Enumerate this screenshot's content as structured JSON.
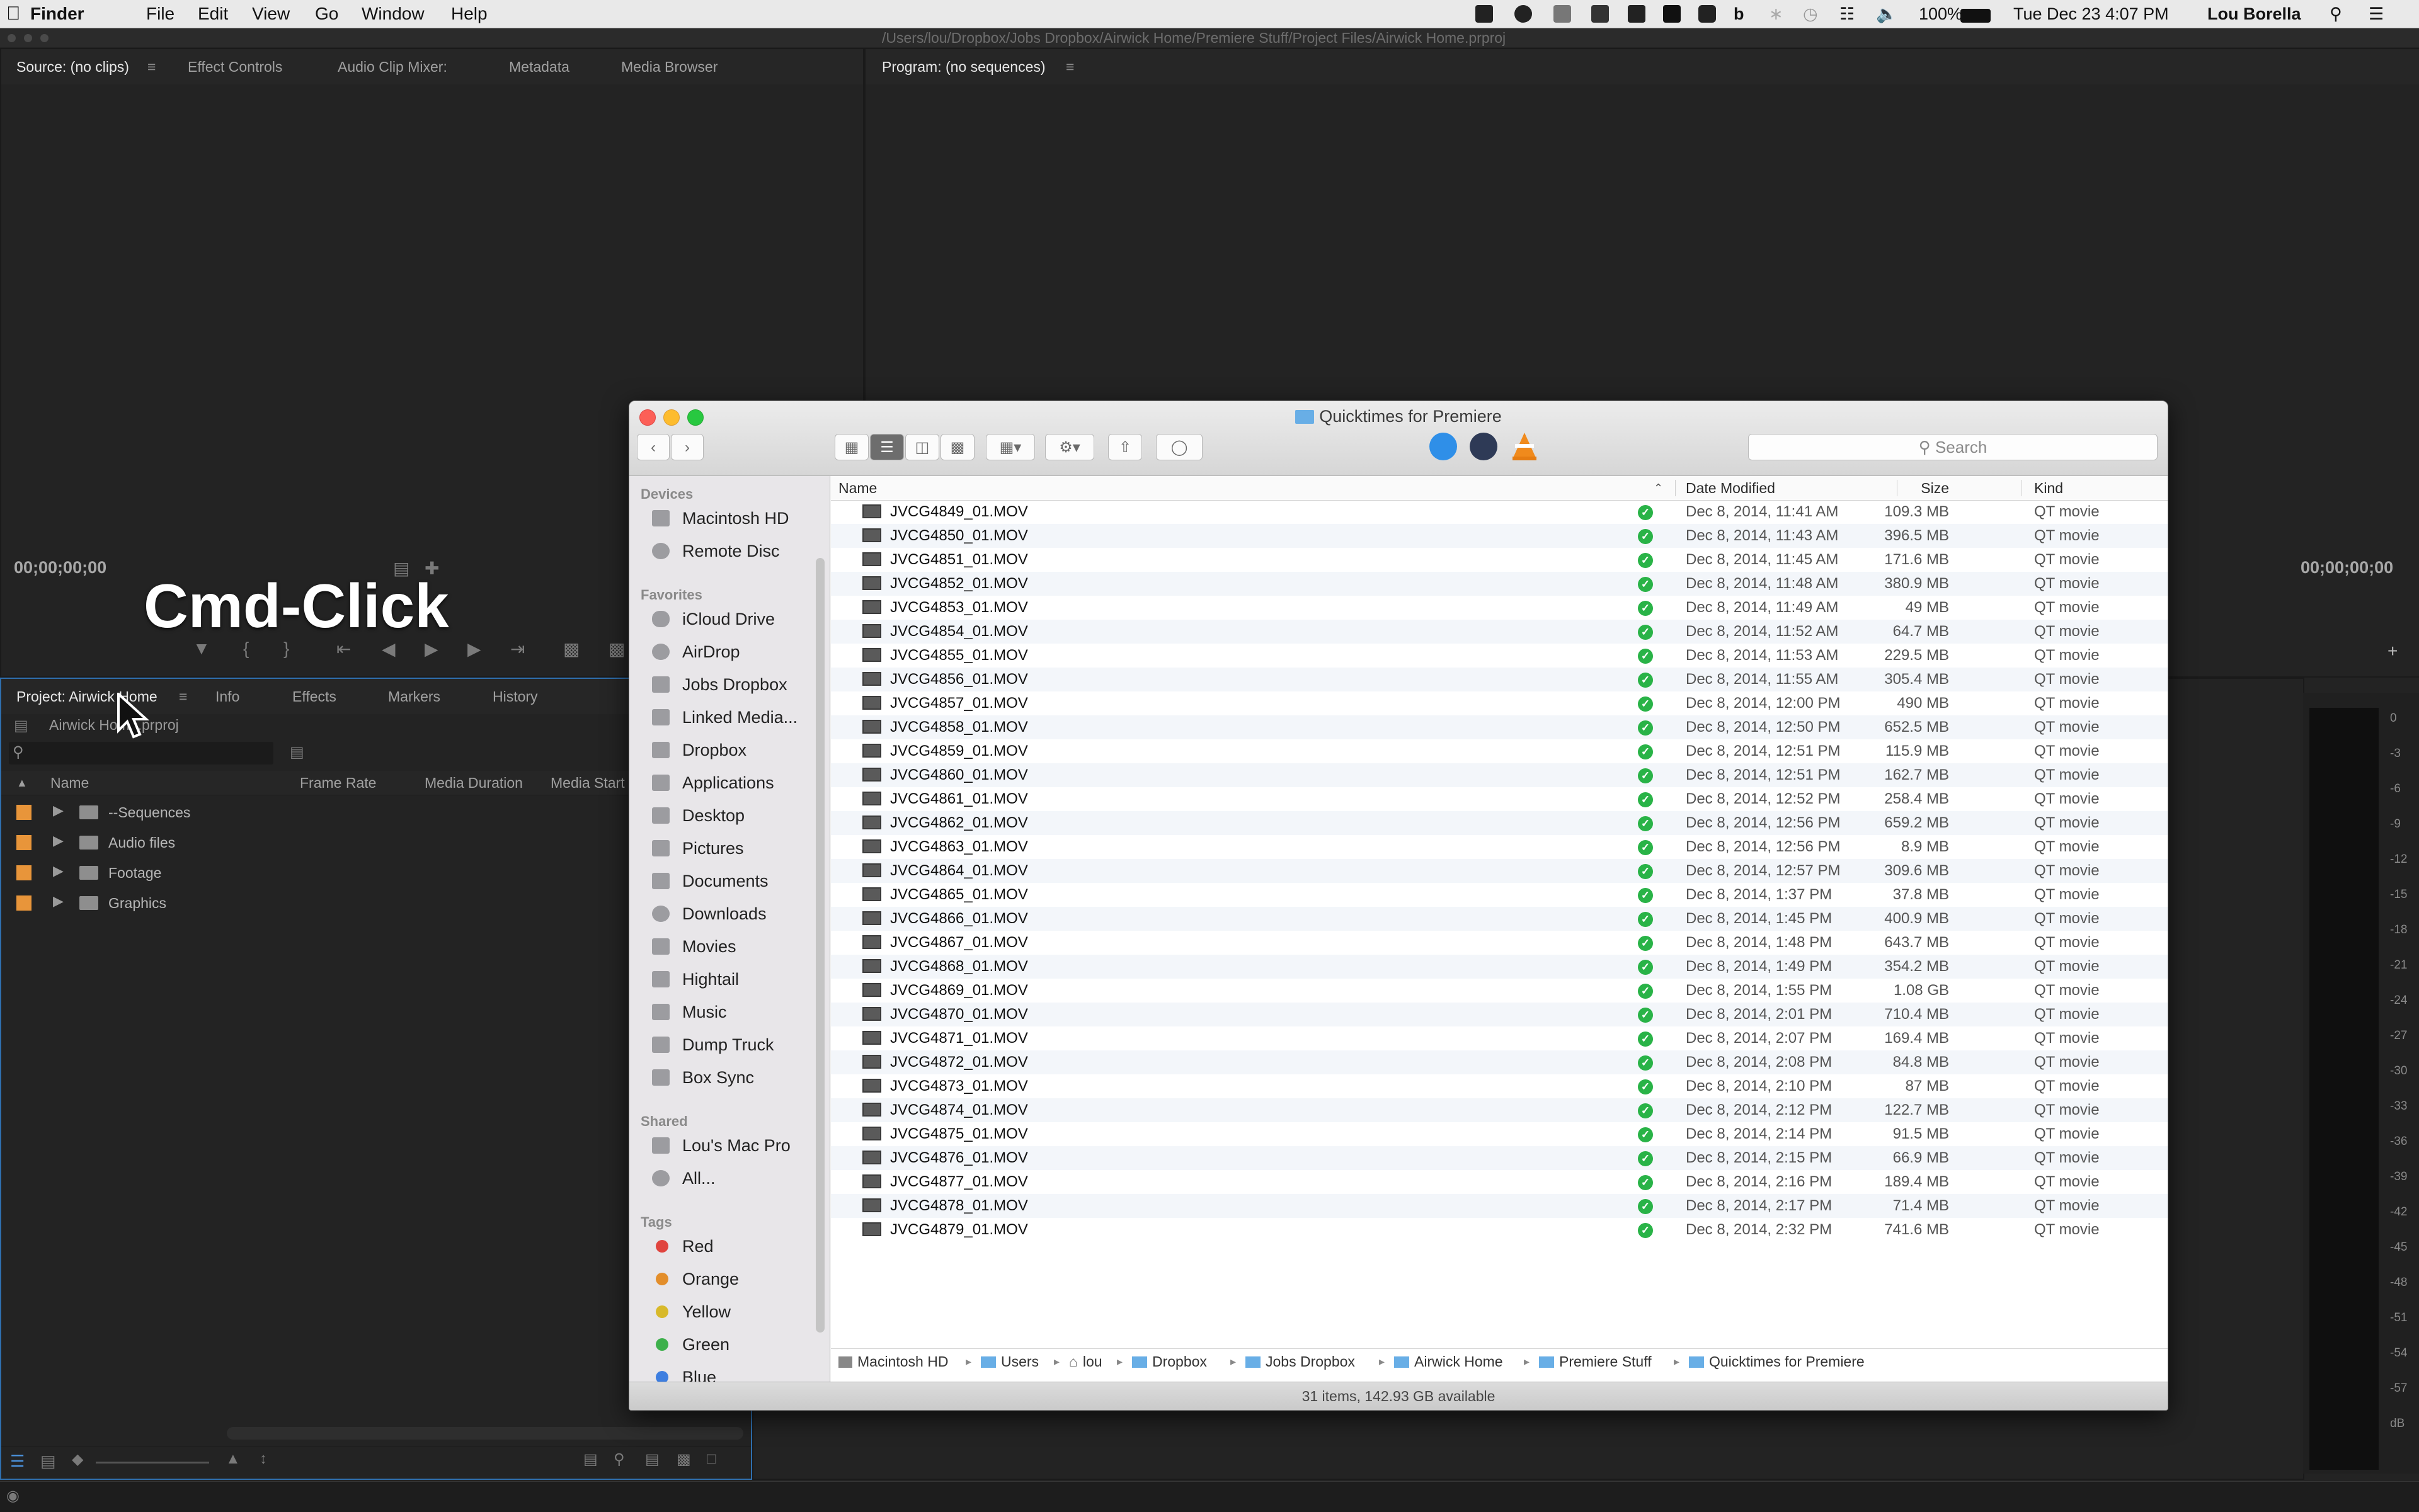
{
  "menubar": {
    "apple": "",
    "app": "Finder",
    "menus": [
      "File",
      "Edit",
      "View",
      "Go",
      "Window",
      "Help"
    ],
    "battery": "100%",
    "clock": "Tue Dec 23  4:07 PM",
    "user": "Lou Borella",
    "status_icons": [
      "dropbox-icon",
      "creative-cloud-icon",
      "monitor-icon",
      "calendar-icon",
      "bar-icon",
      "app-icon",
      "display-icon",
      "b-icon",
      "bluetooth-icon",
      "timemachine-icon",
      "wifi-icon",
      "volume-icon",
      "battery-icon",
      "spotlight-icon",
      "notification-icon"
    ]
  },
  "premiere": {
    "title_path": "/Users/lou/Dropbox/Jobs Dropbox/Airwick Home/Premiere Stuff/Project Files/Airwick Home.prproj",
    "source_tabs": [
      "Source: (no clips)",
      "Effect Controls",
      "Audio Clip Mixer:",
      "Metadata",
      "Media Browser"
    ],
    "program_tab": "Program: (no sequences)",
    "source_timecode": "00;00;00;00",
    "program_timecode": "00;00;00;00",
    "project_tabs": [
      "Project: Airwick Home",
      "Info",
      "Effects",
      "Markers",
      "History"
    ],
    "project_file": "Airwick Home.prproj",
    "project_columns": [
      "Name",
      "Frame Rate",
      "Media Duration",
      "Media Start"
    ],
    "project_items": [
      "--Sequences",
      "Audio files",
      "Footage",
      "Graphics"
    ],
    "overlay_text": "Cmd-Click",
    "meter_ticks": [
      "0",
      "-3",
      "-6",
      "-9",
      "-12",
      "-15",
      "-18",
      "-21",
      "-24",
      "-27",
      "-30",
      "-33",
      "-36",
      "-39",
      "-42",
      "-45",
      "-48",
      "-51",
      "-54",
      "-57",
      "dB"
    ]
  },
  "finder": {
    "title": "Quicktimes for Premiere",
    "search_placeholder": "Search",
    "sidebar": {
      "devices_label": "Devices",
      "devices": [
        "Macintosh HD",
        "Remote Disc"
      ],
      "favorites_label": "Favorites",
      "favorites": [
        "iCloud Drive",
        "AirDrop",
        "Jobs Dropbox",
        "Linked Media...",
        "Dropbox",
        "Applications",
        "Desktop",
        "Pictures",
        "Documents",
        "Downloads",
        "Movies",
        "Hightail",
        "Music",
        "Dump Truck",
        "Box Sync"
      ],
      "shared_label": "Shared",
      "shared": [
        "Lou's Mac Pro",
        "All..."
      ],
      "tags_label": "Tags",
      "tags": [
        {
          "name": "Red",
          "color": "#e0443e"
        },
        {
          "name": "Orange",
          "color": "#e38e2b"
        },
        {
          "name": "Yellow",
          "color": "#d8b92a"
        },
        {
          "name": "Green",
          "color": "#3db04b"
        },
        {
          "name": "Blue",
          "color": "#3d7ee0"
        }
      ]
    },
    "columns": {
      "name": "Name",
      "date": "Date Modified",
      "size": "Size",
      "kind": "Kind"
    },
    "files": [
      {
        "name": "JVCG4849_01.MOV",
        "date": "Dec 8, 2014, 11:41 AM",
        "size": "109.3 MB",
        "kind": "QT movie"
      },
      {
        "name": "JVCG4850_01.MOV",
        "date": "Dec 8, 2014, 11:43 AM",
        "size": "396.5 MB",
        "kind": "QT movie"
      },
      {
        "name": "JVCG4851_01.MOV",
        "date": "Dec 8, 2014, 11:45 AM",
        "size": "171.6 MB",
        "kind": "QT movie"
      },
      {
        "name": "JVCG4852_01.MOV",
        "date": "Dec 8, 2014, 11:48 AM",
        "size": "380.9 MB",
        "kind": "QT movie"
      },
      {
        "name": "JVCG4853_01.MOV",
        "date": "Dec 8, 2014, 11:49 AM",
        "size": "49 MB",
        "kind": "QT movie"
      },
      {
        "name": "JVCG4854_01.MOV",
        "date": "Dec 8, 2014, 11:52 AM",
        "size": "64.7 MB",
        "kind": "QT movie"
      },
      {
        "name": "JVCG4855_01.MOV",
        "date": "Dec 8, 2014, 11:53 AM",
        "size": "229.5 MB",
        "kind": "QT movie"
      },
      {
        "name": "JVCG4856_01.MOV",
        "date": "Dec 8, 2014, 11:55 AM",
        "size": "305.4 MB",
        "kind": "QT movie"
      },
      {
        "name": "JVCG4857_01.MOV",
        "date": "Dec 8, 2014, 12:00 PM",
        "size": "490 MB",
        "kind": "QT movie"
      },
      {
        "name": "JVCG4858_01.MOV",
        "date": "Dec 8, 2014, 12:50 PM",
        "size": "652.5 MB",
        "kind": "QT movie"
      },
      {
        "name": "JVCG4859_01.MOV",
        "date": "Dec 8, 2014, 12:51 PM",
        "size": "115.9 MB",
        "kind": "QT movie"
      },
      {
        "name": "JVCG4860_01.MOV",
        "date": "Dec 8, 2014, 12:51 PM",
        "size": "162.7 MB",
        "kind": "QT movie"
      },
      {
        "name": "JVCG4861_01.MOV",
        "date": "Dec 8, 2014, 12:52 PM",
        "size": "258.4 MB",
        "kind": "QT movie"
      },
      {
        "name": "JVCG4862_01.MOV",
        "date": "Dec 8, 2014, 12:56 PM",
        "size": "659.2 MB",
        "kind": "QT movie"
      },
      {
        "name": "JVCG4863_01.MOV",
        "date": "Dec 8, 2014, 12:56 PM",
        "size": "8.9 MB",
        "kind": "QT movie"
      },
      {
        "name": "JVCG4864_01.MOV",
        "date": "Dec 8, 2014, 12:57 PM",
        "size": "309.6 MB",
        "kind": "QT movie"
      },
      {
        "name": "JVCG4865_01.MOV",
        "date": "Dec 8, 2014, 1:37 PM",
        "size": "37.8 MB",
        "kind": "QT movie"
      },
      {
        "name": "JVCG4866_01.MOV",
        "date": "Dec 8, 2014, 1:45 PM",
        "size": "400.9 MB",
        "kind": "QT movie"
      },
      {
        "name": "JVCG4867_01.MOV",
        "date": "Dec 8, 2014, 1:48 PM",
        "size": "643.7 MB",
        "kind": "QT movie"
      },
      {
        "name": "JVCG4868_01.MOV",
        "date": "Dec 8, 2014, 1:49 PM",
        "size": "354.2 MB",
        "kind": "QT movie"
      },
      {
        "name": "JVCG4869_01.MOV",
        "date": "Dec 8, 2014, 1:55 PM",
        "size": "1.08 GB",
        "kind": "QT movie"
      },
      {
        "name": "JVCG4870_01.MOV",
        "date": "Dec 8, 2014, 2:01 PM",
        "size": "710.4 MB",
        "kind": "QT movie"
      },
      {
        "name": "JVCG4871_01.MOV",
        "date": "Dec 8, 2014, 2:07 PM",
        "size": "169.4 MB",
        "kind": "QT movie"
      },
      {
        "name": "JVCG4872_01.MOV",
        "date": "Dec 8, 2014, 2:08 PM",
        "size": "84.8 MB",
        "kind": "QT movie"
      },
      {
        "name": "JVCG4873_01.MOV",
        "date": "Dec 8, 2014, 2:10 PM",
        "size": "87 MB",
        "kind": "QT movie"
      },
      {
        "name": "JVCG4874_01.MOV",
        "date": "Dec 8, 2014, 2:12 PM",
        "size": "122.7 MB",
        "kind": "QT movie"
      },
      {
        "name": "JVCG4875_01.MOV",
        "date": "Dec 8, 2014, 2:14 PM",
        "size": "91.5 MB",
        "kind": "QT movie"
      },
      {
        "name": "JVCG4876_01.MOV",
        "date": "Dec 8, 2014, 2:15 PM",
        "size": "66.9 MB",
        "kind": "QT movie"
      },
      {
        "name": "JVCG4877_01.MOV",
        "date": "Dec 8, 2014, 2:16 PM",
        "size": "189.4 MB",
        "kind": "QT movie"
      },
      {
        "name": "JVCG4878_01.MOV",
        "date": "Dec 8, 2014, 2:17 PM",
        "size": "71.4 MB",
        "kind": "QT movie"
      },
      {
        "name": "JVCG4879_01.MOV",
        "date": "Dec 8, 2014, 2:32 PM",
        "size": "741.6 MB",
        "kind": "QT movie"
      }
    ],
    "path": [
      "Macintosh HD",
      "Users",
      "lou",
      "Dropbox",
      "Jobs Dropbox",
      "Airwick Home",
      "Premiere Stuff",
      "Quicktimes for Premiere"
    ],
    "status": "31 items, 142.93 GB available"
  }
}
